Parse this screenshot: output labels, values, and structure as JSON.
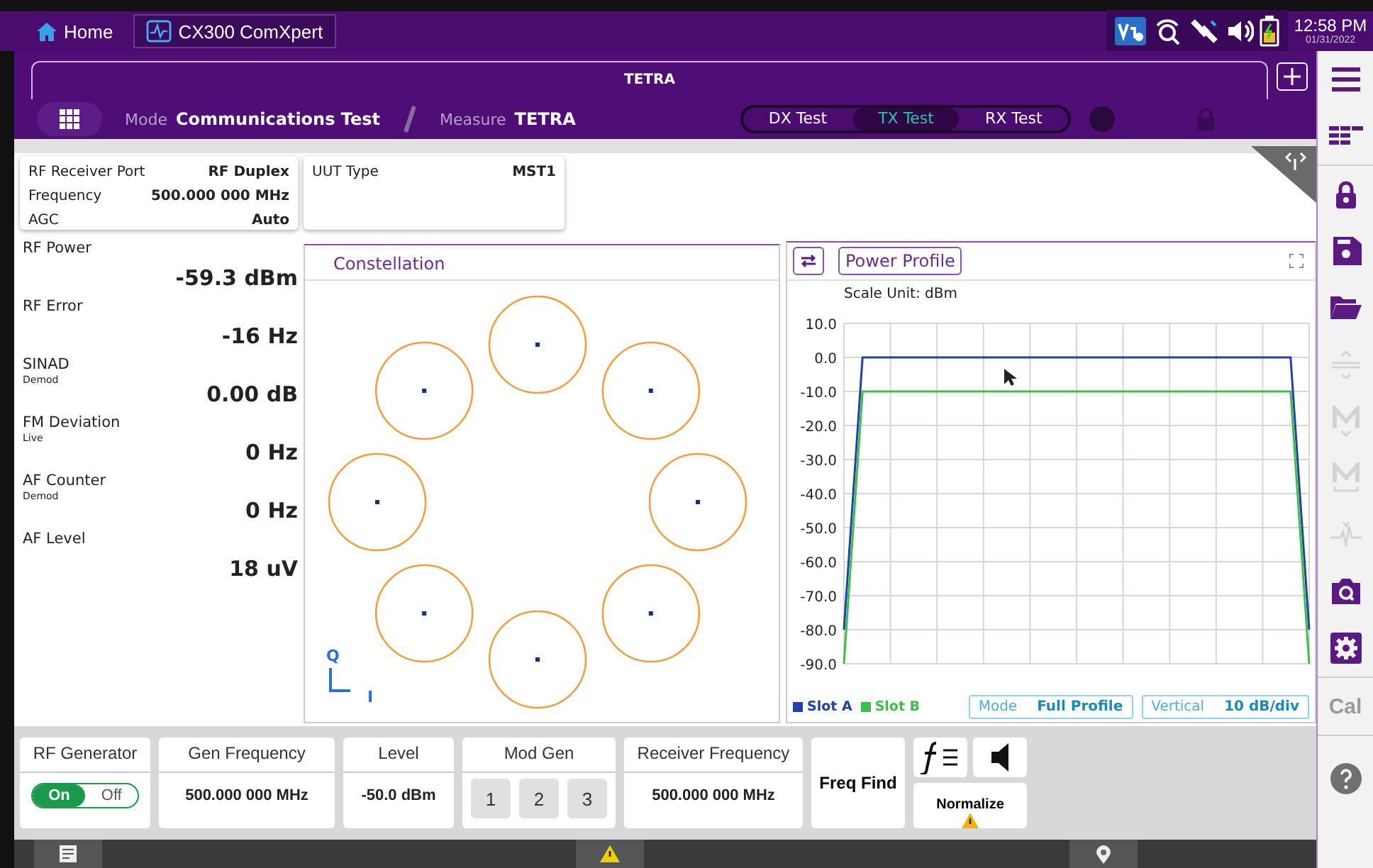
{
  "top_bar": {
    "home": "Home",
    "app_tab": "CX300 ComXpert",
    "time": "12:58 PM",
    "date": "01/31/2022"
  },
  "header": {
    "tab": "TETRA",
    "mode_label": "Mode",
    "mode": "Communications Test",
    "measure_label": "Measure",
    "measure": "TETRA",
    "test_tabs": [
      {
        "label": "DX Test",
        "selected": false
      },
      {
        "label": "TX Test",
        "selected": true
      },
      {
        "label": "RX Test",
        "selected": false
      }
    ]
  },
  "receiver_info": [
    {
      "label": "RF Receiver Port",
      "value": "RF Duplex"
    },
    {
      "label": "Frequency",
      "value": "500.000 000 MHz"
    },
    {
      "label": "AGC",
      "value": "Auto"
    }
  ],
  "uut": {
    "label": "UUT Type",
    "value": "MST1"
  },
  "measurements": [
    {
      "label": "RF Power",
      "value": "-59.3 dBm"
    },
    {
      "label": "RF Error",
      "value": "-16 Hz"
    },
    {
      "label": "SINAD",
      "sub": "Demod",
      "value": "0.00 dB"
    },
    {
      "label": "FM Deviation",
      "sub": "Live",
      "value": "0 Hz"
    },
    {
      "label": "AF Counter",
      "sub": "Demod",
      "value": "0 Hz"
    },
    {
      "label": "AF Level",
      "value": "18 uV"
    }
  ],
  "constellation": {
    "title": "Constellation",
    "q_label": "Q",
    "i_label": "I"
  },
  "power_profile": {
    "title": "Power Profile",
    "scale_unit": "Scale Unit: dBm",
    "chart_data": {
      "type": "line",
      "grid": true,
      "categories": [
        null,
        null,
        null,
        null,
        null,
        null,
        null,
        null,
        null,
        null,
        null,
        null,
        null,
        null,
        null,
        null,
        null,
        null,
        null,
        null,
        null,
        null,
        null,
        null,
        null,
        null
      ],
      "ylim": [
        -90,
        10
      ],
      "yticks": [
        {
          "value": 10,
          "label": "10.0"
        },
        {
          "value": 0,
          "label": "0.0"
        },
        {
          "value": -10,
          "label": "-10.0"
        },
        {
          "value": -20,
          "label": "-20.0"
        },
        {
          "value": -30,
          "label": "-30.0"
        },
        {
          "value": -40,
          "label": "-40.0"
        },
        {
          "value": -50,
          "label": "-50.0"
        },
        {
          "value": -60,
          "label": "-60.0"
        },
        {
          "value": -70,
          "label": "-70.0"
        },
        {
          "value": -80,
          "label": "-80.0"
        },
        {
          "value": -90,
          "label": "-90.0"
        }
      ],
      "series": [
        {
          "name": "Slot A",
          "color": "#2140a8",
          "values": [
            -80,
            0,
            0,
            0,
            0,
            0,
            0,
            0,
            0,
            0,
            0,
            0,
            0,
            0,
            0,
            0,
            0,
            0,
            0,
            0,
            0,
            0,
            0,
            0,
            0,
            -80
          ]
        },
        {
          "name": "Slot B",
          "color": "#3cbf4a",
          "values": [
            -90,
            -10,
            -10,
            -10,
            -10,
            -10,
            -10,
            -10,
            -10,
            -10,
            -10,
            -10,
            -10,
            -10,
            -10,
            -10,
            -10,
            -10,
            -10,
            -10,
            -10,
            -10,
            -10,
            -10,
            -10,
            -90
          ]
        }
      ]
    },
    "mode": {
      "label": "Mode",
      "value": "Full Profile"
    },
    "vertical": {
      "label": "Vertical",
      "value": "10 dB/div"
    }
  },
  "bottom": {
    "rf_generator": {
      "label": "RF Generator",
      "options": [
        {
          "label": "On",
          "selected": true
        },
        {
          "label": "Off",
          "selected": false
        }
      ]
    },
    "gen_frequency": {
      "label": "Gen Frequency",
      "value": "500.000 000 MHz"
    },
    "level": {
      "label": "Level",
      "value": "-50.0 dBm"
    },
    "mod_gen": {
      "label": "Mod Gen",
      "buttons": [
        "1",
        "2",
        "3"
      ]
    },
    "receiver_frequency": {
      "label": "Receiver Frequency",
      "value": "500.000 000 MHz"
    },
    "freq_find": "Freq Find",
    "normalize": "Normalize"
  },
  "sidebar": [
    {
      "kind": "menu",
      "disabled": false
    },
    {
      "kind": "layout",
      "disabled": false
    },
    {
      "kind": "lock",
      "disabled": false
    },
    {
      "kind": "save",
      "disabled": false
    },
    {
      "kind": "folder",
      "disabled": false
    },
    {
      "kind": "split",
      "disabled": true
    },
    {
      "kind": "marker",
      "disabled": true
    },
    {
      "kind": "marker-table",
      "disabled": true
    },
    {
      "kind": "peak",
      "disabled": true
    },
    {
      "kind": "camera",
      "disabled": false
    },
    {
      "kind": "settings",
      "disabled": false
    },
    {
      "kind": "text",
      "label": "Cal",
      "disabled": true
    },
    {
      "kind": "help",
      "disabled": false
    }
  ]
}
